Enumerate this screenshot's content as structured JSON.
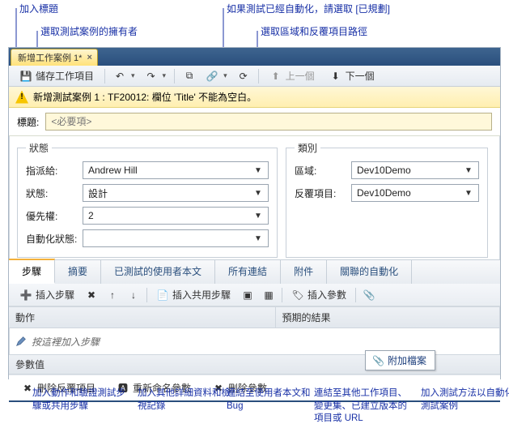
{
  "callouts": {
    "top": {
      "add_title": "加入標題",
      "select_owner": "選取測試案例的擁有者",
      "automation_planned": "如果測試已經自動化，請選取 [已規劃]",
      "area_iteration": "選取區域和反覆項目路徑"
    },
    "bottom": {
      "bc1": "加入動作和驗證測試步驟或共用步驟",
      "bc2": "加入其他詳細資料和檢視記錄",
      "bc3": "連結至使用者本文和 Bug",
      "bc4": "連結至其他工作項目、變更集、已建立版本的項目或 URL",
      "bc5": "加入測試方法以自動化測試案例"
    }
  },
  "window": {
    "tab_title": "新增工作案例 1*",
    "toolbar": {
      "save": "儲存工作項目",
      "prev": "上一個",
      "next": "下一個"
    },
    "warn": "新增測試案例 1 : TF20012: 欄位 'Title' 不能為空白。",
    "title_label": "標題:",
    "title_placeholder": "<必要項>",
    "status_group": "狀態",
    "status": {
      "assigned_label": "指派給:",
      "assigned_value": "Andrew Hill",
      "state_label": "狀態:",
      "state_value": "設計",
      "priority_label": "優先權:",
      "priority_value": "2",
      "automation_label": "自動化狀態:",
      "automation_value": ""
    },
    "class_group": "類別",
    "class": {
      "area_label": "區域:",
      "area_value": "Dev10Demo",
      "iteration_label": "反覆項目:",
      "iteration_value": "Dev10Demo"
    },
    "tabs": {
      "steps": "步驟",
      "summary": "摘要",
      "tested_userstory": "已測試的使用者本文",
      "all_links": "所有連結",
      "attachments": "附件",
      "associated_automation": "關聯的自動化"
    },
    "inner_toolbar": {
      "insert_step": "插入步驟",
      "insert_shared": "插入共用步驟",
      "insert_param": "插入參數"
    },
    "grid": {
      "action_header": "動作",
      "expected_header": "預期的結果",
      "placeholder_row": "按這裡加入步驟"
    },
    "param_section_label": "參數值",
    "attach_popup": "附加檔案",
    "param_tools": {
      "remove_iter": "刪除反覆項目",
      "rename": "重新命名參數",
      "remove_param": "刪除參數"
    }
  }
}
